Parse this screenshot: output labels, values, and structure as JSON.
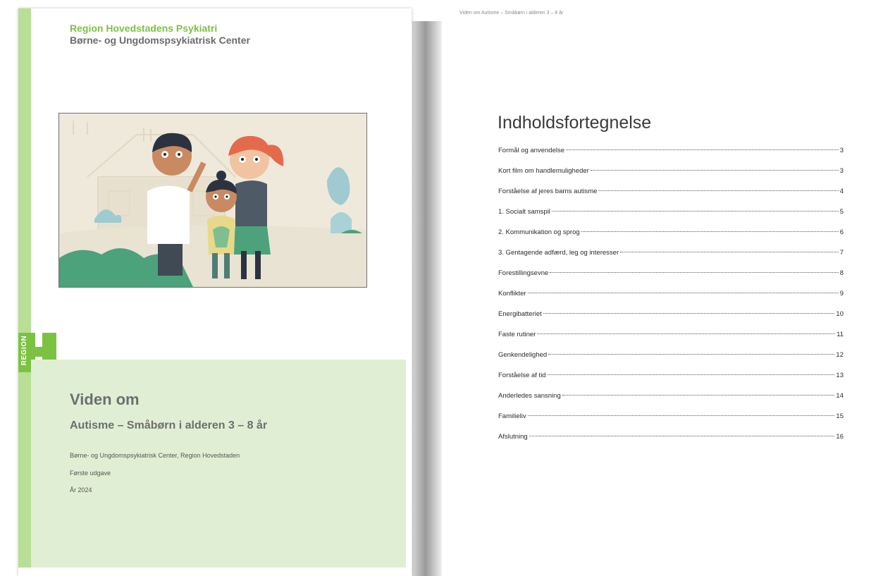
{
  "cover": {
    "org_name": "Region Hovedstadens Psykiatri",
    "org_sub": "Børne- og Ungdomspsykiatrisk Center",
    "region_word": "REGION",
    "title": "Viden om",
    "subtitle": "Autisme – Småbørn i alderen 3 – 8 år",
    "meta": [
      "Børne- og Ungdomspsykiatrisk Center, Region Hovedstaden",
      "Første udgave",
      "År 2024"
    ],
    "colors": {
      "accent_green": "#7cc242",
      "bar_green": "#b7df95",
      "panel_green": "#e0efd3"
    }
  },
  "toc": {
    "running_header": "Viden om Autisme – Småbørn i alderen 3 – 8 år",
    "heading": "Indholdsfortegnelse",
    "entries": [
      {
        "label": "Formål og anvendelse",
        "page": "3"
      },
      {
        "label": "Kort film om handlemuligheder",
        "page": "3"
      },
      {
        "label": "Forståelse af jeres barns autisme",
        "page": "4"
      },
      {
        "label": "1. Socialt samspil",
        "page": "5"
      },
      {
        "label": "2. Kommunikation og sprog",
        "page": "6"
      },
      {
        "label": "3. Gentagende adfærd, leg og interesser",
        "page": "7"
      },
      {
        "label": "Forestillingsevne",
        "page": "8"
      },
      {
        "label": "Konflikter",
        "page": "9"
      },
      {
        "label": "Energibatteriet",
        "page": "10"
      },
      {
        "label": "Faste rutiner",
        "page": "11"
      },
      {
        "label": "Genkendelighed",
        "page": "12"
      },
      {
        "label": "Forståelse af tid",
        "page": "13"
      },
      {
        "label": "Anderledes sansning",
        "page": "14"
      },
      {
        "label": "Familieliv",
        "page": "15"
      },
      {
        "label": "Afslutning",
        "page": "16"
      }
    ]
  }
}
